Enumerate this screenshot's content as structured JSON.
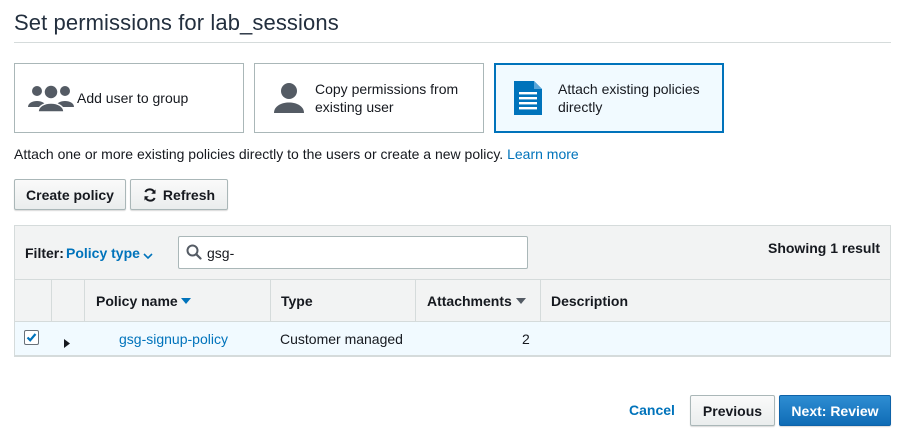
{
  "page": {
    "title": "Set permissions for lab_sessions"
  },
  "options": [
    {
      "label": "Add user to group",
      "icon": "users-group-icon"
    },
    {
      "label_line1": "Copy permissions from",
      "label_line2": "existing user",
      "icon": "user-icon"
    },
    {
      "label_line1": "Attach existing policies",
      "label_line2": "directly",
      "icon": "document-icon",
      "selected": true
    }
  ],
  "intro": {
    "text": "Attach one or more existing policies directly to the users or create a new policy.",
    "link": "Learn more"
  },
  "toolbar": {
    "create_label": "Create policy",
    "refresh_label": "Refresh"
  },
  "filter": {
    "label": "Filter:",
    "value": "Policy type",
    "search_value": "gsg-",
    "showing": "Showing 1 result"
  },
  "table": {
    "columns": [
      "Policy name",
      "Type",
      "Attachments",
      "Description"
    ],
    "rows": [
      {
        "checked": true,
        "policy_name": "gsg-signup-policy",
        "type": "Customer managed",
        "attachments": "2",
        "description": ""
      }
    ]
  },
  "footer": {
    "cancel_label": "Cancel",
    "previous_label": "Previous",
    "next_label": "Next: Review"
  },
  "colors": {
    "accent": "#0073bb",
    "selected_bg": "#f1faff",
    "border": "#aab7b8",
    "header_bg": "#f2f3f3",
    "primary_button": "#1a7ec4"
  }
}
